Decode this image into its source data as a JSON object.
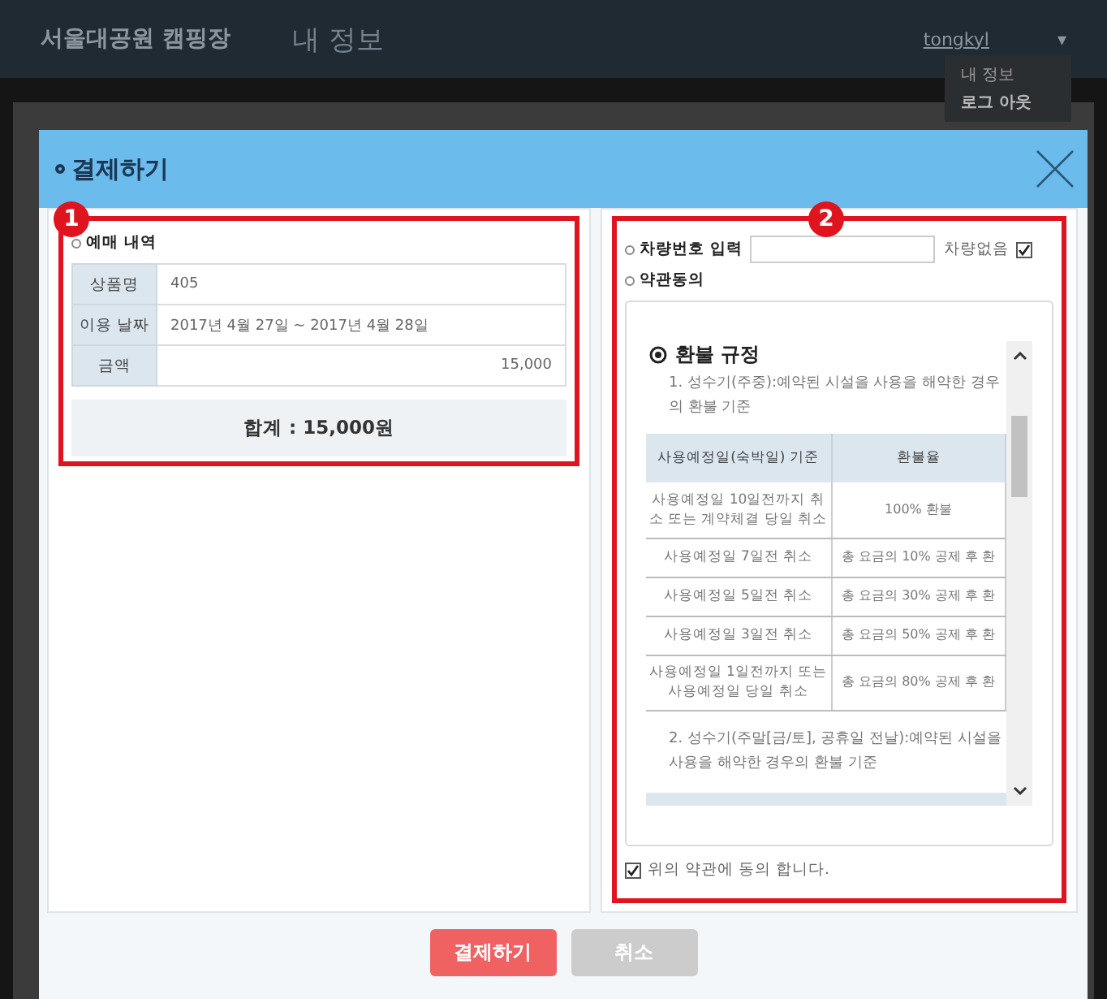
{
  "header": {
    "site_title": "서울대공원 캠핑장",
    "page_title": "내 정보",
    "username": "tongkyl",
    "caret": "▾"
  },
  "user_menu": {
    "items": [
      {
        "label": "내 정보"
      },
      {
        "label": "로그 아웃"
      }
    ]
  },
  "modal": {
    "title": "결제하기"
  },
  "annotations": [
    {
      "label": "1"
    },
    {
      "label": "2"
    }
  ],
  "reservation": {
    "heading": "예매 내역",
    "rows": [
      {
        "label": "상품명",
        "value": "405",
        "numeric": false
      },
      {
        "label": "이용 날짜",
        "value": "2017년 4월 27일 ~ 2017년 4월 28일",
        "numeric": false
      },
      {
        "label": "금액",
        "value": "15,000",
        "numeric": true
      }
    ],
    "total": "합계 : 15,000원"
  },
  "vehicle": {
    "label": "차량번호 입력",
    "no_vehicle_label": "차량없음",
    "no_vehicle_checked": true
  },
  "terms": {
    "heading": "약관동의",
    "title": "환불 규정",
    "para1": "1. 성수기(주중):예약된 시설을 사용을 해약한 경우의 환불 기준",
    "columns": [
      "사용예정일(숙박일) 기준",
      "환불율"
    ],
    "rows": [
      [
        "사용예정일 10일전까지 취소 또는 계약체결 당일 취소",
        "100% 환불"
      ],
      [
        "사용예정일 7일전 취소",
        "총 요금의 10% 공제 후 환"
      ],
      [
        "사용예정일 5일전 취소",
        "총 요금의 30% 공제 후 환"
      ],
      [
        "사용예정일 3일전 취소",
        "총 요금의 50% 공제 후 환"
      ],
      [
        "사용예정일 1일전까지 또는 사용예정일 당일 취소",
        "총 요금의 80% 공제 후 환"
      ]
    ],
    "para2": "2. 성수기(주말[금/토], 공휴일 전날):예약된 시설을 사용을 해약한 경우의 환불 기준"
  },
  "agree": {
    "label": "위의 약관에 동의 합니다.",
    "checked": true
  },
  "buttons": [
    {
      "label": "결제하기",
      "kind": "primary"
    },
    {
      "label": "취소",
      "kind": "secondary"
    }
  ]
}
